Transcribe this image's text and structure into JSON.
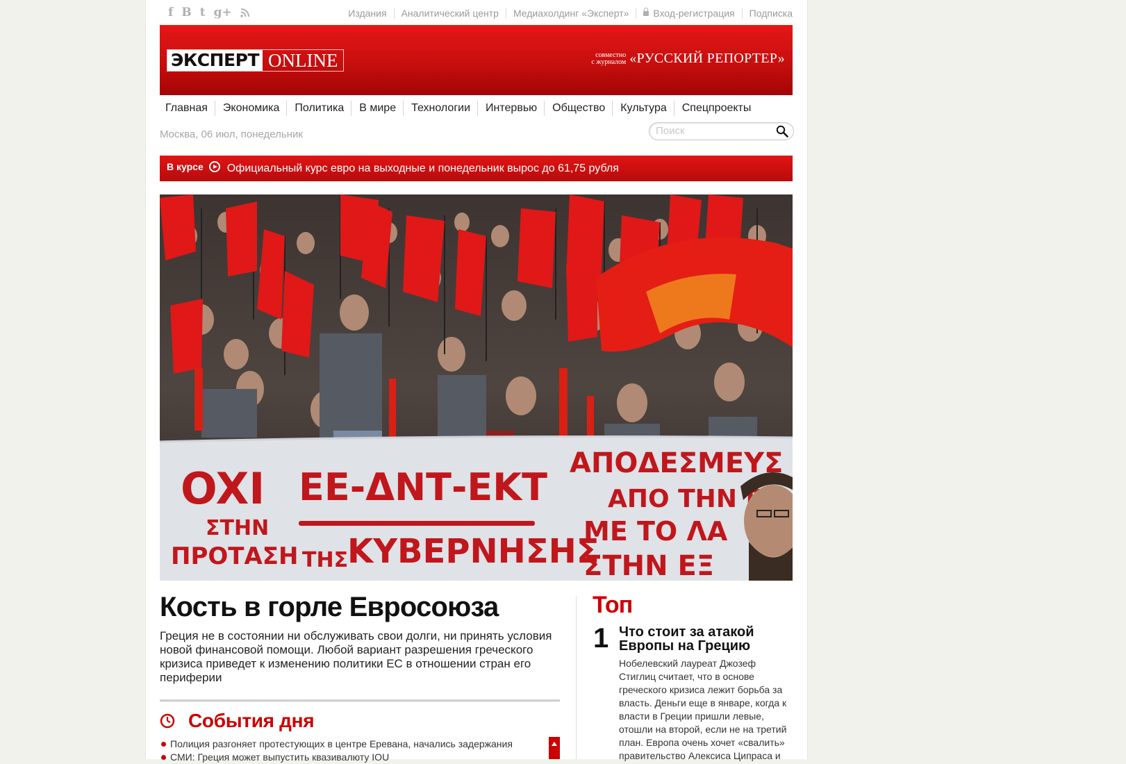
{
  "topbar": {
    "social": [
      {
        "glyph": "f",
        "name": "facebook-icon"
      },
      {
        "glyph": "B",
        "name": "vkontakte-icon"
      },
      {
        "glyph": "t",
        "name": "twitter-icon"
      },
      {
        "glyph": "g+",
        "name": "google-plus-icon"
      },
      {
        "glyph": "",
        "name": "rss-icon"
      }
    ],
    "links": [
      "Издания",
      "Аналитический центр",
      "Медиахолдинг «Эксперт»",
      "Вход-регистрация",
      "Подписка"
    ]
  },
  "header": {
    "logo_main": "ЭКСПЕРТ",
    "logo_suffix": "ONLINE",
    "partner_line1": "совместно",
    "partner_line2": "с журналом",
    "partner_name": "«РУССКИЙ РЕПОРТЕР»"
  },
  "nav": [
    "Главная",
    "Экономика",
    "Политика",
    "В мире",
    "Технологии",
    "Интервью",
    "Общество",
    "Культура",
    "Спецпроекты"
  ],
  "date": "Москва, 06 июл, понедельник",
  "search": {
    "placeholder": "Поиск"
  },
  "ticker": {
    "label": "В курсе",
    "text": "Официальный курс евро на выходные и понедельник вырос до 61,75 рубля"
  },
  "hero": {
    "banner_words": [
      "OXI",
      "ΣΤΗΝ",
      "ΠΡΟΤΑΣΗ",
      "ΕΕ-ΔΝΤ-ΕΚΤ",
      "ΤΗΣ",
      "ΚΥΒΕΡΝΗΣΗΣ",
      "ΑΠΟΔΕΣΜΕΥΣ",
      "ΑΠΟ ΤΗΝ Ε",
      "ΜΕ ΤΟ ΛΑ",
      "ΣΤΗΝ ΕΞ"
    ]
  },
  "article": {
    "headline": "Кость в горле Евросоюза",
    "lead": "Греция не в состоянии ни обслуживать свои долги, ни принять условия новой финансовой помощи. Любой вариант разрешения греческого кризиса приведет к изменению политики ЕС в отношении стран его периферии"
  },
  "events": {
    "title": "События дня",
    "items": [
      "Полиция разгоняет протестующих в центре Еревана, начались задержания",
      "СМИ: Греция может выпустить квазивалюту IOU"
    ]
  },
  "top": {
    "title": "Топ",
    "items": [
      {
        "num": "1",
        "headline": "Что стоит за атакой Европы на Грецию",
        "desc": "Нобелевский лауреат Джозеф Стиглиц считает, что в основе греческого кризиса лежит борьба за власть. Деньги еще в январе, когда к власти в Греции пришли левые, отошли на второй, если не на третий план. Европа очень хочет «свалить» правительство Алексиса Ципраса и"
      }
    ]
  },
  "colors": {
    "brand_red": "#cc0000",
    "header_red": "#d11010",
    "banner_text_red": "#c0171c"
  }
}
